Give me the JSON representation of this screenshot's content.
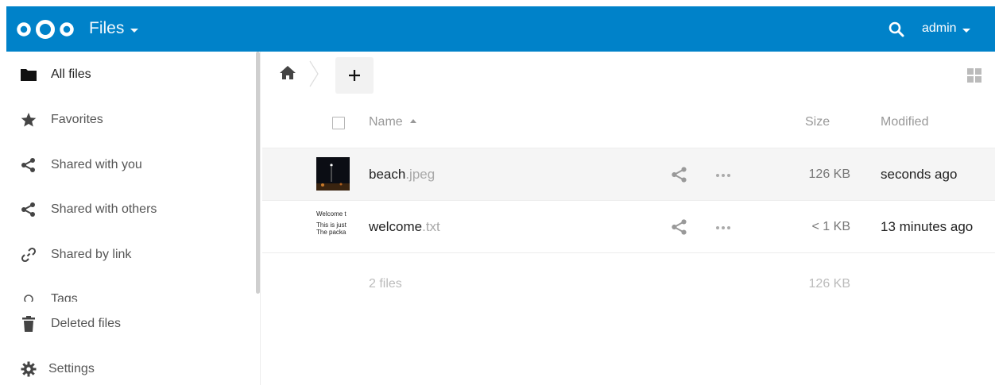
{
  "header": {
    "app_name": "Files",
    "user": "admin",
    "brand_color": "#0082c9"
  },
  "sidebar": {
    "items": [
      {
        "label": "All files",
        "icon": "folder-icon"
      },
      {
        "label": "Favorites",
        "icon": "star-icon"
      },
      {
        "label": "Shared with you",
        "icon": "share-icon"
      },
      {
        "label": "Shared with others",
        "icon": "share-icon"
      },
      {
        "label": "Shared by link",
        "icon": "link-icon"
      },
      {
        "label": "Tags",
        "icon": "tag-icon"
      }
    ],
    "bottom": [
      {
        "label": "Deleted files",
        "icon": "trash-icon"
      },
      {
        "label": "Settings",
        "icon": "gear-icon"
      }
    ]
  },
  "toolbar": {
    "add_label": "+"
  },
  "table": {
    "columns": {
      "name": "Name",
      "size": "Size",
      "modified": "Modified"
    },
    "rows": [
      {
        "base": "beach",
        "ext": ".jpeg",
        "size": "126 KB",
        "modified": "seconds ago"
      },
      {
        "base": "welcome",
        "ext": ".txt",
        "size": "< 1 KB",
        "modified": "13 minutes ago",
        "preview": [
          "Welcome t",
          "This is just",
          "The packa"
        ]
      }
    ],
    "summary": {
      "count": "2 files",
      "total": "126 KB"
    }
  }
}
